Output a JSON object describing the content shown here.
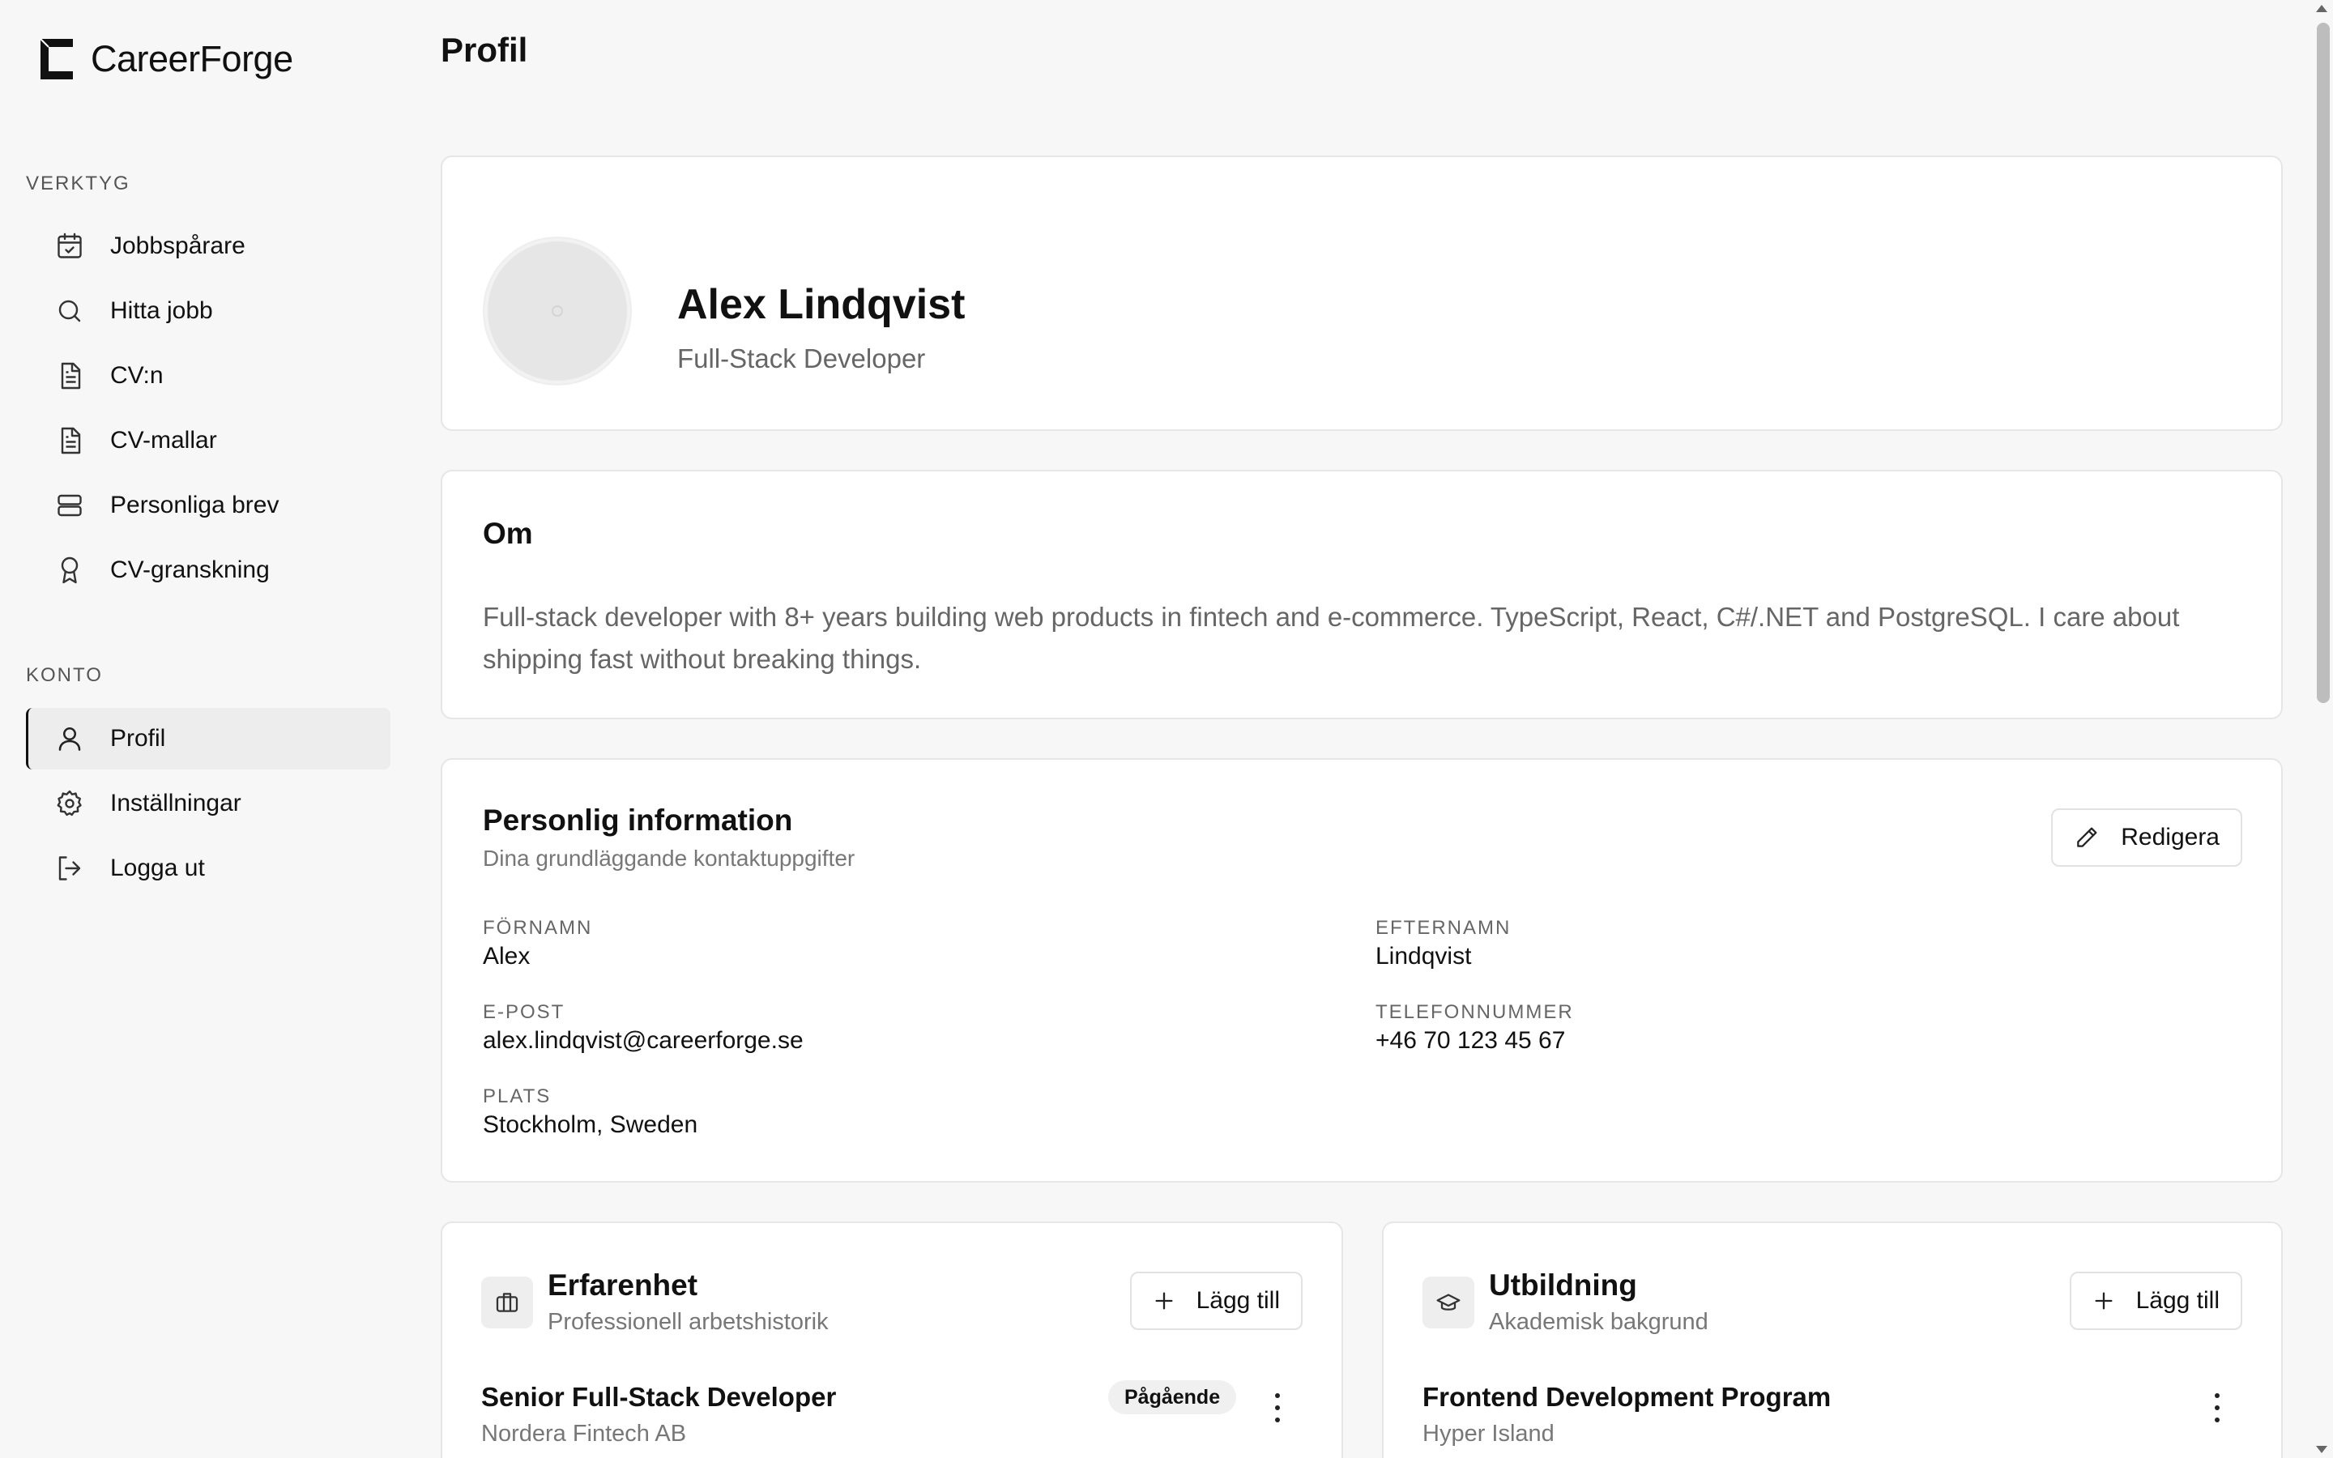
{
  "brand": {
    "name": "CareerForge"
  },
  "sidebar": {
    "sections": [
      {
        "title": "VERKTYG",
        "items": [
          {
            "label": "Jobbspårare",
            "icon": "calendar-check-icon"
          },
          {
            "label": "Hitta jobb",
            "icon": "search-icon"
          },
          {
            "label": "CV:n",
            "icon": "document-icon"
          },
          {
            "label": "CV-mallar",
            "icon": "document-icon"
          },
          {
            "label": "Personliga brev",
            "icon": "letters-icon"
          },
          {
            "label": "CV-granskning",
            "icon": "award-icon"
          }
        ]
      },
      {
        "title": "KONTO",
        "items": [
          {
            "label": "Profil",
            "icon": "user-icon",
            "active": true
          },
          {
            "label": "Inställningar",
            "icon": "gear-icon"
          },
          {
            "label": "Logga ut",
            "icon": "logout-icon"
          }
        ]
      }
    ]
  },
  "page": {
    "title": "Profil"
  },
  "profile": {
    "name": "Alex Lindqvist",
    "role": "Full-Stack Developer"
  },
  "about": {
    "title": "Om",
    "text": "Full-stack developer with 8+ years building web products in fintech and e-commerce. TypeScript, React, C#/.NET and PostgreSQL. I care about shipping fast without breaking things."
  },
  "personal": {
    "title": "Personlig information",
    "subtitle": "Dina grundläggande kontaktuppgifter",
    "edit_label": "Redigera",
    "fields": {
      "first_name": {
        "label": "FÖRNAMN",
        "value": "Alex"
      },
      "last_name": {
        "label": "EFTERNAMN",
        "value": "Lindqvist"
      },
      "email": {
        "label": "E-POST",
        "value": "alex.lindqvist@careerforge.se"
      },
      "phone": {
        "label": "TELEFONNUMMER",
        "value": "+46 70 123 45 67"
      },
      "location": {
        "label": "PLATS",
        "value": "Stockholm, Sweden"
      }
    }
  },
  "experience": {
    "title": "Erfarenhet",
    "subtitle": "Professionell arbetshistorik",
    "add_label": "Lägg till",
    "entries": [
      {
        "title": "Senior Full-Stack Developer",
        "org": "Nordera Fintech AB",
        "badge": "Pågående"
      }
    ]
  },
  "education": {
    "title": "Utbildning",
    "subtitle": "Akademisk bakgrund",
    "add_label": "Lägg till",
    "entries": [
      {
        "title": "Frontend Development Program",
        "org": "Hyper Island"
      }
    ]
  }
}
